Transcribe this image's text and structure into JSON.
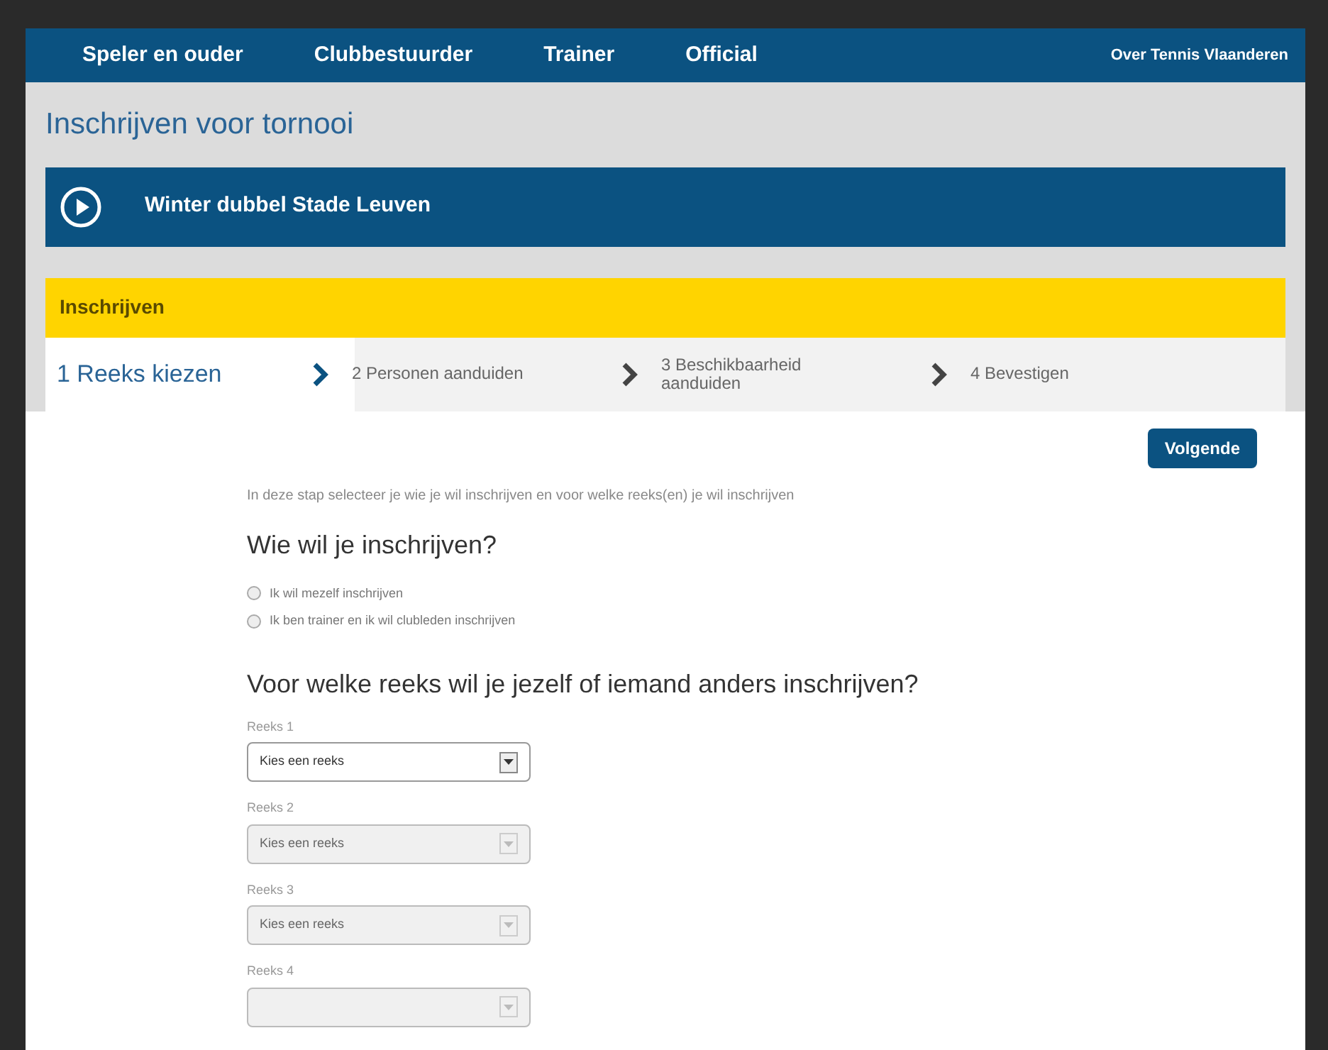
{
  "nav": {
    "items": [
      "Speler en ouder",
      "Clubbestuurder",
      "Trainer",
      "Official"
    ],
    "right_link": "Over Tennis Vlaanderen"
  },
  "page_title": "Inschrijven voor tornooi",
  "tournament": {
    "name": "Winter dubbel Stade Leuven"
  },
  "section": {
    "title": "Inschrijven"
  },
  "steps": [
    {
      "label": "1 Reeks kiezen",
      "selected": true
    },
    {
      "label": "2 Personen aanduiden",
      "selected": false
    },
    {
      "label": "3 Beschikbaarheid aanduiden",
      "selected": false
    },
    {
      "label": "4 Bevestigen",
      "selected": false
    }
  ],
  "next_button": "Volgende",
  "intro": "In deze stap selecteer je wie je wil inschrijven en voor welke reeks(en) je wil inschrijven",
  "who_heading": "Wie wil je inschrijven?",
  "who_options": [
    {
      "label": "Ik wil mezelf inschrijven",
      "selected": false
    },
    {
      "label": "Ik ben trainer en ik wil clubleden inschrijven",
      "selected": false
    }
  ],
  "series_heading": "Voor welke reeks wil je jezelf of iemand anders inschrijven?",
  "series": [
    {
      "label": "Reeks 1",
      "value": "Kies een reeks",
      "disabled": false
    },
    {
      "label": "Reeks 2",
      "value": "Kies een reeks",
      "disabled": true
    },
    {
      "label": "Reeks 3",
      "value": "Kies een reeks",
      "disabled": true
    },
    {
      "label": "Reeks 4",
      "disabled": true
    }
  ]
}
